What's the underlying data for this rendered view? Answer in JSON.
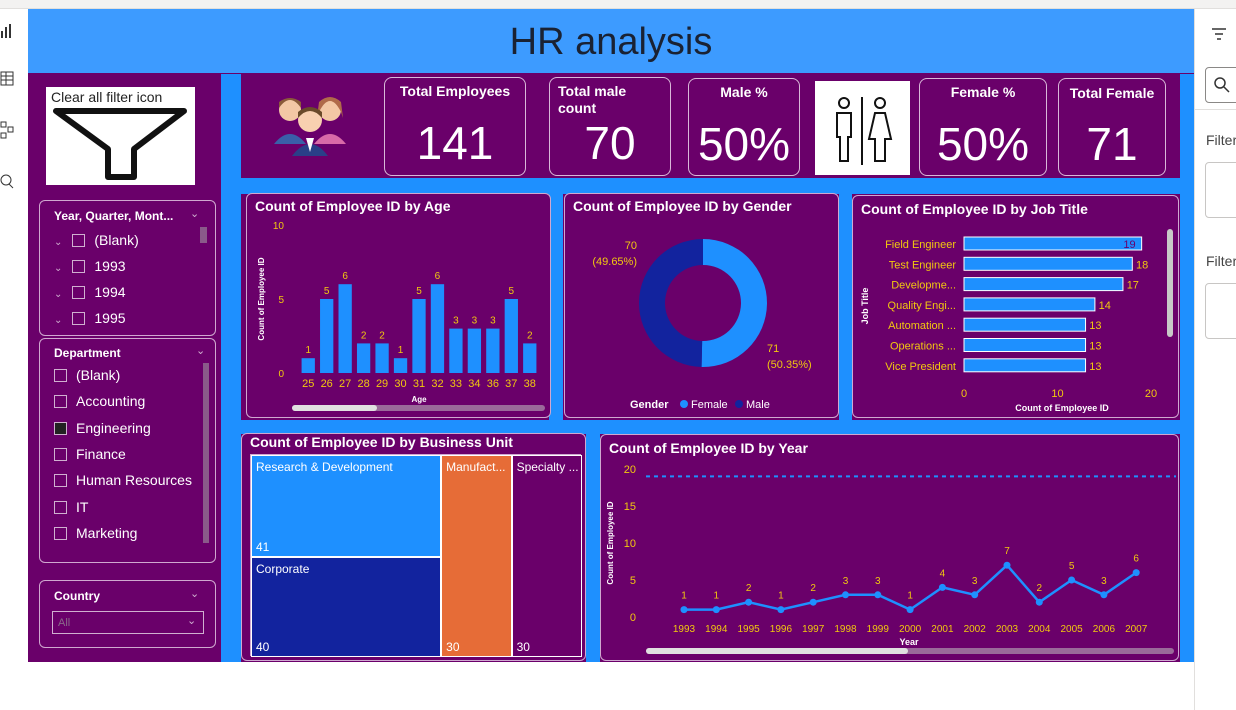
{
  "header": {
    "title": "HR analysis"
  },
  "filter_button": {
    "label": "Clear all filter icon"
  },
  "slicers": {
    "year": {
      "title": "Year, Quarter, Mont...",
      "items": [
        "(Blank)",
        "1993",
        "1994",
        "1995"
      ]
    },
    "department": {
      "title": "Department",
      "items": [
        {
          "label": "(Blank)",
          "checked": false
        },
        {
          "label": "Accounting",
          "checked": false
        },
        {
          "label": "Engineering",
          "checked": true
        },
        {
          "label": "Finance",
          "checked": false
        },
        {
          "label": "Human Resources",
          "checked": false
        },
        {
          "label": "IT",
          "checked": false
        },
        {
          "label": "Marketing",
          "checked": false
        }
      ]
    },
    "country": {
      "title": "Country",
      "value": "All"
    }
  },
  "kpis": {
    "total_employees": {
      "label": "Total Employees",
      "value": "141"
    },
    "total_male": {
      "label": "Total male count",
      "value": "70"
    },
    "male_pct": {
      "label": "Male %",
      "value": "50%"
    },
    "female_pct": {
      "label": "Female %",
      "value": "50%"
    },
    "total_female": {
      "label": "Total Female",
      "value": "71"
    }
  },
  "right_pane": {
    "filter_label_1": "Filter",
    "filter_label_2": "Filter"
  },
  "colors": {
    "bar": "#1e90ff",
    "dark_blue": "#12239e",
    "orange": "#e66c37",
    "bg": "#6a006a",
    "label": "#f2c80f"
  },
  "chart_data": [
    {
      "id": "age",
      "type": "bar",
      "title": "Count of Employee ID by Age",
      "xlabel": "Age",
      "ylabel": "Count of Employee ID",
      "ylim": [
        0,
        10
      ],
      "yticks": [
        "0",
        "5",
        "10"
      ],
      "categories": [
        "25",
        "26",
        "27",
        "28",
        "29",
        "30",
        "31",
        "32",
        "33",
        "34",
        "36",
        "37",
        "38"
      ],
      "values": [
        1,
        5,
        6,
        2,
        2,
        1,
        5,
        6,
        3,
        3,
        3,
        5,
        2
      ]
    },
    {
      "id": "gender",
      "type": "pie",
      "title": "Count of Employee ID by Gender",
      "legend_title": "Gender",
      "legend": [
        "Female",
        "Male"
      ],
      "values": [
        71,
        70
      ],
      "labels": [
        {
          "count": "71",
          "pct": "(50.35%)"
        },
        {
          "count": "70",
          "pct": "(49.65%)"
        }
      ]
    },
    {
      "id": "job",
      "type": "bar",
      "orientation": "horizontal",
      "title": "Count of Employee ID by Job Title",
      "xlabel": "Count of Employee ID",
      "ylabel": "Job Title",
      "xlim": [
        0,
        20
      ],
      "xticks": [
        "0",
        "10",
        "20"
      ],
      "categories": [
        "Field Engineer",
        "Test Engineer",
        "Developme...",
        "Quality Engi...",
        "Automation ...",
        "Operations ...",
        "Vice President"
      ],
      "values": [
        19,
        18,
        17,
        14,
        13,
        13,
        13
      ]
    },
    {
      "id": "business",
      "type": "heatmap",
      "title": "Count of Employee ID by Business Unit",
      "cells": [
        {
          "name": "Research & Development",
          "value": 41
        },
        {
          "name": "Corporate",
          "value": 40
        },
        {
          "name": "Manufact...",
          "value": 30
        },
        {
          "name": "Specialty ...",
          "value": 30
        }
      ]
    },
    {
      "id": "year",
      "type": "line",
      "title": "Count of Employee ID by Year",
      "xlabel": "Year",
      "ylabel": "Count of Employee ID",
      "ylim": [
        0,
        20
      ],
      "yticks": [
        "0",
        "5",
        "10",
        "15",
        "20"
      ],
      "x": [
        "1993",
        "1994",
        "1995",
        "1996",
        "1997",
        "1998",
        "1999",
        "2000",
        "2001",
        "2002",
        "2003",
        "2004",
        "2005",
        "2006",
        "2007"
      ],
      "values": [
        1,
        1,
        2,
        1,
        2,
        3,
        3,
        1,
        4,
        3,
        7,
        2,
        5,
        3,
        6
      ]
    }
  ]
}
